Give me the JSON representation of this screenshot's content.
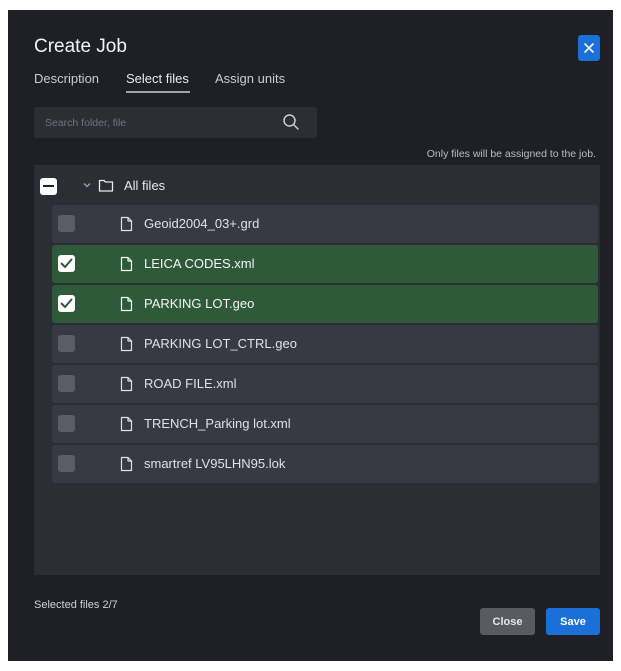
{
  "dialog": {
    "title": "Create Job",
    "close_icon": "close-icon",
    "accent_color": "#1a6fd8",
    "selected_row_color": "#2e5a39"
  },
  "tabs": [
    {
      "label": "Description",
      "active": false
    },
    {
      "label": "Select files",
      "active": true
    },
    {
      "label": "Assign units",
      "active": false
    }
  ],
  "search": {
    "placeholder": "Search folder, file",
    "value": "",
    "icon": "search-icon"
  },
  "hint": "Only files will be assigned to the job.",
  "tree": {
    "root": {
      "label": "All files",
      "state": "indeterminate",
      "icon": "folder-icon",
      "expanded": true
    },
    "files": [
      {
        "name": "Geoid2004_03+.grd",
        "checked": false
      },
      {
        "name": "LEICA CODES.xml",
        "checked": true
      },
      {
        "name": "PARKING LOT.geo",
        "checked": true
      },
      {
        "name": "PARKING LOT_CTRL.geo",
        "checked": false
      },
      {
        "name": "ROAD FILE.xml",
        "checked": false
      },
      {
        "name": "TRENCH_Parking lot.xml",
        "checked": false
      },
      {
        "name": "smartref LV95LHN95.lok",
        "checked": false
      }
    ]
  },
  "footer": {
    "selected_text": "Selected files 2/7",
    "close_label": "Close",
    "save_label": "Save"
  }
}
